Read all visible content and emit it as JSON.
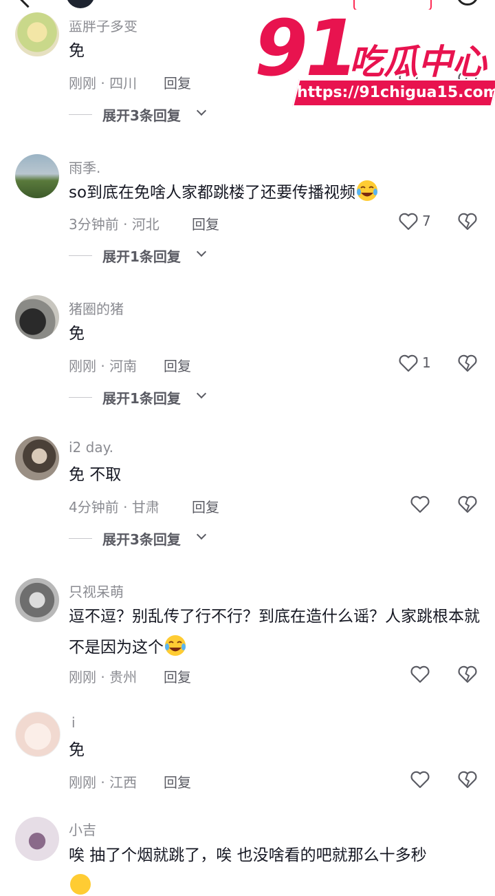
{
  "watermark": {
    "number": "91",
    "title": "吃瓜中心",
    "url": "https://91chigua15.com"
  },
  "comments": [
    {
      "name": "蓝胖子多变",
      "text": "免",
      "time": "刚刚",
      "location": "四川",
      "reply": "回复",
      "likes": "",
      "expand": "展开3条回复"
    },
    {
      "name": "雨季.",
      "text": "so到底在免啥人家都跳楼了还要传播视频",
      "time": "3分钟前",
      "location": "河北",
      "reply": "回复",
      "likes": "7",
      "expand": "展开1条回复"
    },
    {
      "name": "猪圈的猪",
      "text": "免",
      "time": "刚刚",
      "location": "河南",
      "reply": "回复",
      "likes": "1",
      "expand": "展开1条回复"
    },
    {
      "name": "i2 day.",
      "text": "免 不取",
      "time": "4分钟前",
      "location": "甘肃",
      "reply": "回复",
      "likes": "",
      "expand": "展开3条回复"
    },
    {
      "name": "只视呆萌",
      "text": "逗不逗？别乱传了行不行？到底在造什么谣？人家跳根本就不是因为这个",
      "time": "刚刚",
      "location": "贵州",
      "reply": "回复",
      "likes": ""
    },
    {
      "name": "i",
      "text": "免",
      "time": "刚刚",
      "location": "江西",
      "reply": "回复",
      "likes": ""
    },
    {
      "name": "小吉",
      "text": "唉 抽了个烟就跳了，唉 也没啥看的吧就那么十多秒"
    }
  ],
  "colors": {
    "accent": "#fe2c55",
    "watermark": "#e8134f",
    "meta": "#8a8b91"
  },
  "icons": {
    "like": "heart-icon",
    "dislike": "broken-heart-icon",
    "emoji": "crying-laughing-emoji"
  }
}
